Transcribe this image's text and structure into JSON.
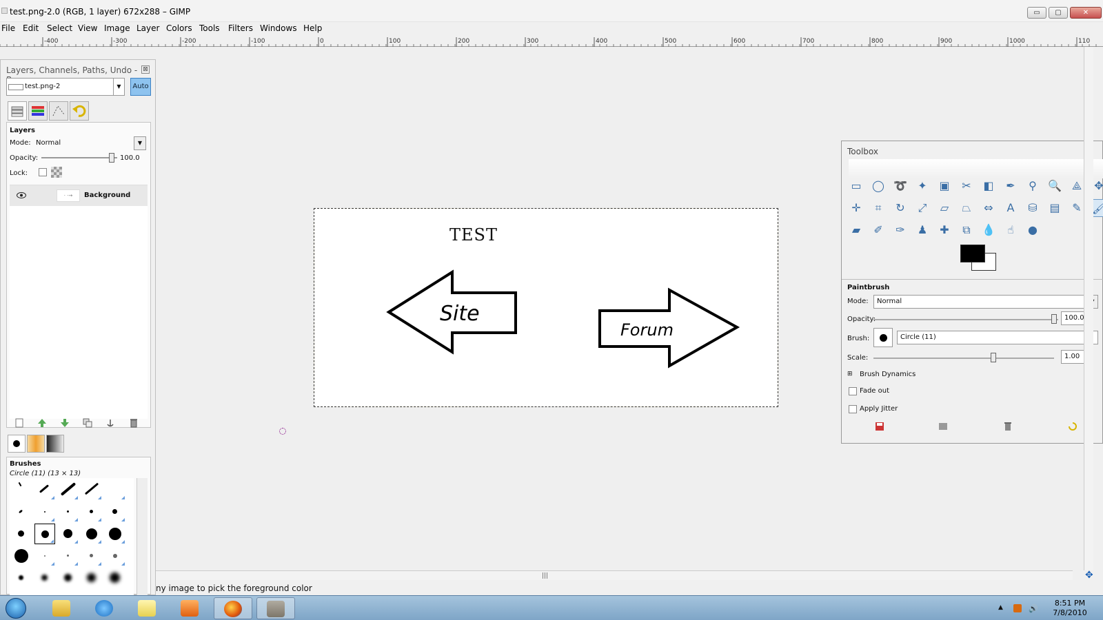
{
  "window": {
    "title": "test.png-2.0 (RGB, 1 layer) 672x288 – GIMP",
    "min_label": "▭",
    "max_label": "▢",
    "close_label": "✕"
  },
  "menu": [
    "File",
    "Edit",
    "Select",
    "View",
    "Image",
    "Layer",
    "Colors",
    "Tools",
    "Filters",
    "Windows",
    "Help"
  ],
  "ruler": {
    "labels": [
      "-400",
      "-300",
      "-200",
      "-100",
      "0",
      "100",
      "200",
      "300",
      "400",
      "500",
      "600",
      "700",
      "800",
      "900",
      "1000",
      "110"
    ]
  },
  "dock": {
    "title": "Layers, Channels, Paths, Undo - Br...",
    "close": "⊠",
    "image_name": "test.png-2",
    "auto_label": "Auto",
    "layers": {
      "heading": "Layers",
      "mode_label": "Mode:",
      "mode_value": "Normal",
      "opacity_label": "Opacity:",
      "opacity_value": "100.0",
      "opacity_fraction": 1.0,
      "lock_label": "Lock:",
      "layer_name": "Background",
      "layer_thumb_text": "· ·→"
    },
    "brushes": {
      "heading": "Brushes",
      "selected": "Circle (11) (13 × 13)"
    }
  },
  "image": {
    "text_test": "TEST",
    "text_site": "Site",
    "text_forum": "Forum"
  },
  "toolbox": {
    "title": "Toolbox",
    "tools": [
      {
        "icon": "rect-select-icon",
        "glyph": "▭"
      },
      {
        "icon": "ellipse-select-icon",
        "glyph": "◯"
      },
      {
        "icon": "free-select-icon",
        "glyph": "➰"
      },
      {
        "icon": "fuzzy-select-icon",
        "glyph": "✦"
      },
      {
        "icon": "color-select-icon",
        "glyph": "▣"
      },
      {
        "icon": "scissors-icon",
        "glyph": "✂"
      },
      {
        "icon": "foreground-select-icon",
        "glyph": "◧"
      },
      {
        "icon": "paths-icon",
        "glyph": "✒"
      },
      {
        "icon": "color-picker-icon",
        "glyph": "⚲"
      },
      {
        "icon": "zoom-icon",
        "glyph": "🔍"
      },
      {
        "icon": "measure-icon",
        "glyph": "⟁"
      },
      {
        "icon": "move-icon",
        "glyph": "✥"
      },
      {
        "icon": "align-icon",
        "glyph": "✛"
      },
      {
        "icon": "crop-icon",
        "glyph": "⌗"
      },
      {
        "icon": "rotate-icon",
        "glyph": "↻"
      },
      {
        "icon": "scale-icon",
        "glyph": "⤢"
      },
      {
        "icon": "shear-icon",
        "glyph": "▱"
      },
      {
        "icon": "perspective-icon",
        "glyph": "⏢"
      },
      {
        "icon": "flip-icon",
        "glyph": "⇔"
      },
      {
        "icon": "text-icon",
        "glyph": "A"
      },
      {
        "icon": "bucket-fill-icon",
        "glyph": "⛁"
      },
      {
        "icon": "blend-icon",
        "glyph": "▤"
      },
      {
        "icon": "pencil-icon",
        "glyph": "✎"
      },
      {
        "icon": "paintbrush-icon",
        "glyph": "🖌"
      },
      {
        "icon": "eraser-icon",
        "glyph": "▰"
      },
      {
        "icon": "airbrush-icon",
        "glyph": "✐"
      },
      {
        "icon": "ink-icon",
        "glyph": "✑"
      },
      {
        "icon": "clone-icon",
        "glyph": "♟"
      },
      {
        "icon": "heal-icon",
        "glyph": "✚"
      },
      {
        "icon": "perspective-clone-icon",
        "glyph": "⧉"
      },
      {
        "icon": "blur-icon",
        "glyph": "💧"
      },
      {
        "icon": "smudge-icon",
        "glyph": "☝"
      },
      {
        "icon": "dodge-burn-icon",
        "glyph": "●"
      }
    ],
    "options": {
      "heading": "Paintbrush",
      "mode_label": "Mode:",
      "mode_value": "Normal",
      "opacity_label": "Opacity:",
      "opacity_value": "100.0",
      "brush_label": "Brush:",
      "brush_value": "Circle (11)",
      "scale_label": "Scale:",
      "scale_value": "1.00",
      "dynamics_label": "Brush Dynamics",
      "fade_label": "Fade out",
      "jitter_label": "Apply Jitter"
    }
  },
  "status": {
    "text": "ny image to pick the foreground color"
  },
  "taskbar": {
    "time": "8:51 PM",
    "date": "7/8/2010"
  },
  "colors": {
    "selection_yellow": "#d9b400",
    "active_blue": "#8ec3ef"
  }
}
